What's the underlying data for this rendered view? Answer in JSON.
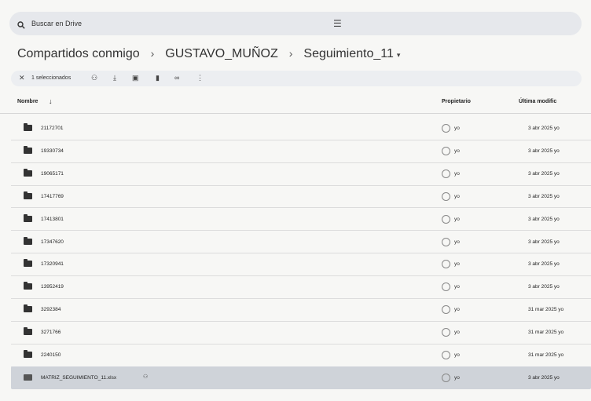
{
  "search": {
    "placeholder": "Buscar en Drive"
  },
  "breadcrumb": {
    "root": "Compartidos conmigo",
    "parent": "GUSTAVO_MUÑOZ",
    "current": "Seguimiento_11"
  },
  "selection_bar": {
    "count_label": "1 seleccionados"
  },
  "table": {
    "col_name": "Nombre",
    "col_owner": "Propietario",
    "col_modified": "Última modific",
    "rows": [
      {
        "name": "21172701",
        "owner": "yo",
        "modified": "3 abr 2025 yo",
        "type": "folder-icon"
      },
      {
        "name": "19330734",
        "owner": "yo",
        "modified": "3 abr 2025 yo",
        "type": "folder-icon"
      },
      {
        "name": "19065171",
        "owner": "yo",
        "modified": "3 abr 2025 yo",
        "type": "folder-icon"
      },
      {
        "name": "17417769",
        "owner": "yo",
        "modified": "3 abr 2025 yo",
        "type": "folder-icon"
      },
      {
        "name": "17413801",
        "owner": "yo",
        "modified": "3 abr 2025 yo",
        "type": "folder-icon"
      },
      {
        "name": "17347620",
        "owner": "yo",
        "modified": "3 abr 2025 yo",
        "type": "folder-icon"
      },
      {
        "name": "17320941",
        "owner": "yo",
        "modified": "3 abr 2025 yo",
        "type": "folder-icon"
      },
      {
        "name": "13952419",
        "owner": "yo",
        "modified": "3 abr 2025 yo",
        "type": "folder-icon"
      },
      {
        "name": "3292384",
        "owner": "yo",
        "modified": "31 mar 2025 yo",
        "type": "folder-icon"
      },
      {
        "name": "3271766",
        "owner": "yo",
        "modified": "31 mar 2025 yo",
        "type": "folder-icon"
      },
      {
        "name": "2240150",
        "owner": "yo",
        "modified": "31 mar 2025 yo",
        "type": "folder-icon"
      },
      {
        "name": "MATRIZ_SEGUIMIENTO_11.xlsx",
        "owner": "yo",
        "modified": "3 abr 2025 yo",
        "type": "spreadsheet-icon",
        "shared": true,
        "selected": true
      }
    ]
  }
}
